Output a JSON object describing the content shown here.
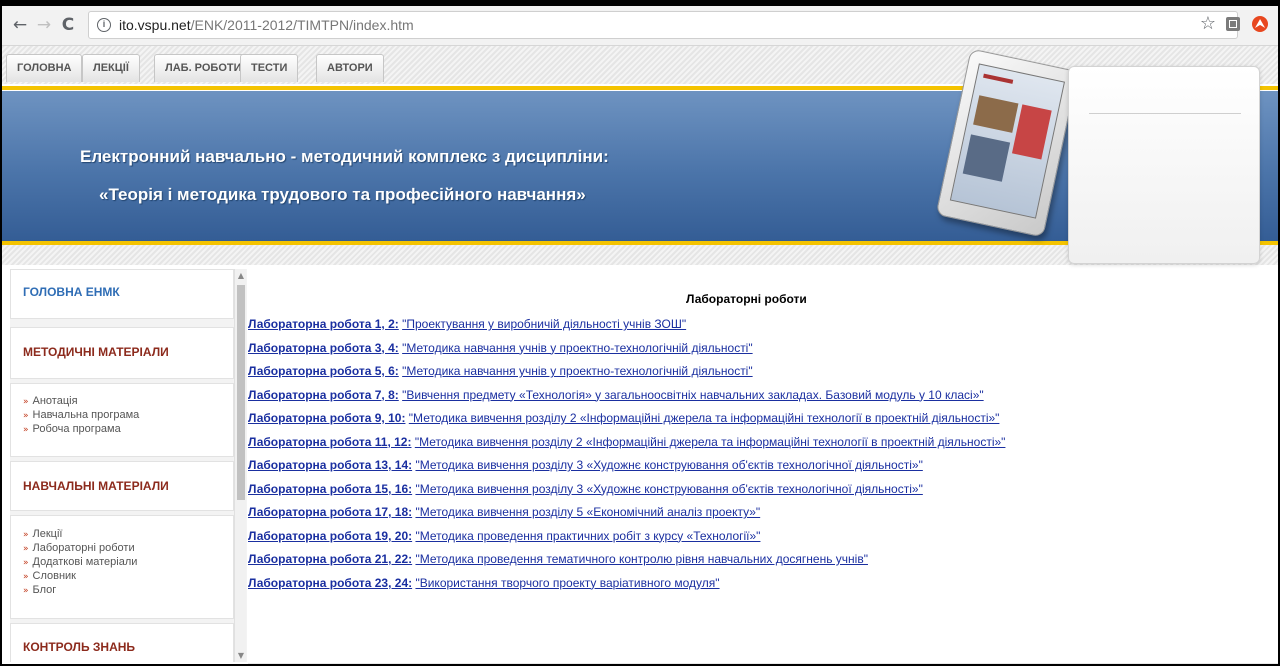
{
  "browser": {
    "url_host": "ito.vspu.net",
    "url_path": "/ENK/2011-2012/TIMTPN/index.htm",
    "info_symbol": "i",
    "back_icon": "←",
    "forward_icon": "→",
    "reload_icon": "C",
    "bookmark_icon": "☆"
  },
  "tabs": [
    "ГОЛОВНА",
    "ЛЕКЦІЇ",
    "ЛАБ. РОБОТИ",
    "ТЕСТИ",
    "АВТОРИ"
  ],
  "banner": {
    "title": "Електронний навчально - методичний комплекс з дисципліни:",
    "subtitle": "«Теорія і методика трудового та професійного навчання»"
  },
  "sidebar": {
    "home_title": "ГОЛОВНА ЕНМК",
    "methodical_title": "МЕТОДИЧНІ МАТЕРІАЛИ",
    "methodical_items": [
      "Анотація",
      "Навчальна програма",
      "Робоча програма"
    ],
    "learning_title": "НАВЧАЛЬНІ МАТЕРІАЛИ",
    "learning_items": [
      "Лекції",
      "Лабораторні роботи",
      "Додаткові матеріали",
      "Словник",
      "Блог"
    ],
    "control_title": "КОНТРОЛЬ ЗНАНЬ",
    "bullet": "»"
  },
  "main": {
    "heading": "Лабораторні роботи",
    "labs": [
      {
        "label": "Лабораторна робота 1, 2:",
        "title": "\"Проектування у виробничій діяльності учнів ЗОШ\""
      },
      {
        "label": "Лабораторна робота 3, 4:",
        "title": "\"Методика навчання учнів у проектно-технологічній діяльності\""
      },
      {
        "label": "Лабораторна робота 5, 6:",
        "title": "\"Методика навчання учнів у проектно-технологічній діяльності\""
      },
      {
        "label": "Лабораторна робота 7, 8:",
        "title": "\"Вивчення предмету «Технологія» у загальноосвітніх навчальних закладах. Базовий модуль у 10 класі»\""
      },
      {
        "label": "Лабораторна робота 9, 10:",
        "title": "\"Методика вивчення розділу 2 «Інформаційні джерела та інформаційні технології в проектній діяльності»\""
      },
      {
        "label": "Лабораторна робота 11, 12:",
        "title": "\"Методика вивчення розділу 2 «Інформаційні джерела та інформаційні технології в проектній діяльності»\""
      },
      {
        "label": "Лабораторна робота 13, 14:",
        "title": "\"Методика вивчення розділу 3 «Художнє конструювання об'єктів технологічної діяльності»\""
      },
      {
        "label": "Лабораторна робота 15, 16:",
        "title": "\"Методика вивчення розділу 3 «Художнє конструювання об'єктів технологічної діяльності»\""
      },
      {
        "label": "Лабораторна робота 17, 18:",
        "title": "\"Методика вивчення розділу 5 «Економічний аналіз проекту»\""
      },
      {
        "label": "Лабораторна робота 19, 20:",
        "title": "\"Методика проведення практичних робіт з курсу «Технології»\""
      },
      {
        "label": "Лабораторна робота 21, 22:",
        "title": "\"Методика проведення тематичного контролю рівня навчальних досягнень учнів\""
      },
      {
        "label": "Лабораторна робота 23, 24:",
        "title": "\"Використання творчого проекту варіативного модуля\""
      }
    ]
  },
  "colors": {
    "link": "#1a2fa0",
    "banner": "#4b74a9",
    "accent_gold": "#f4c300",
    "sidebar_red": "#8c2a1c",
    "sidebar_blue": "#2f6db5"
  }
}
